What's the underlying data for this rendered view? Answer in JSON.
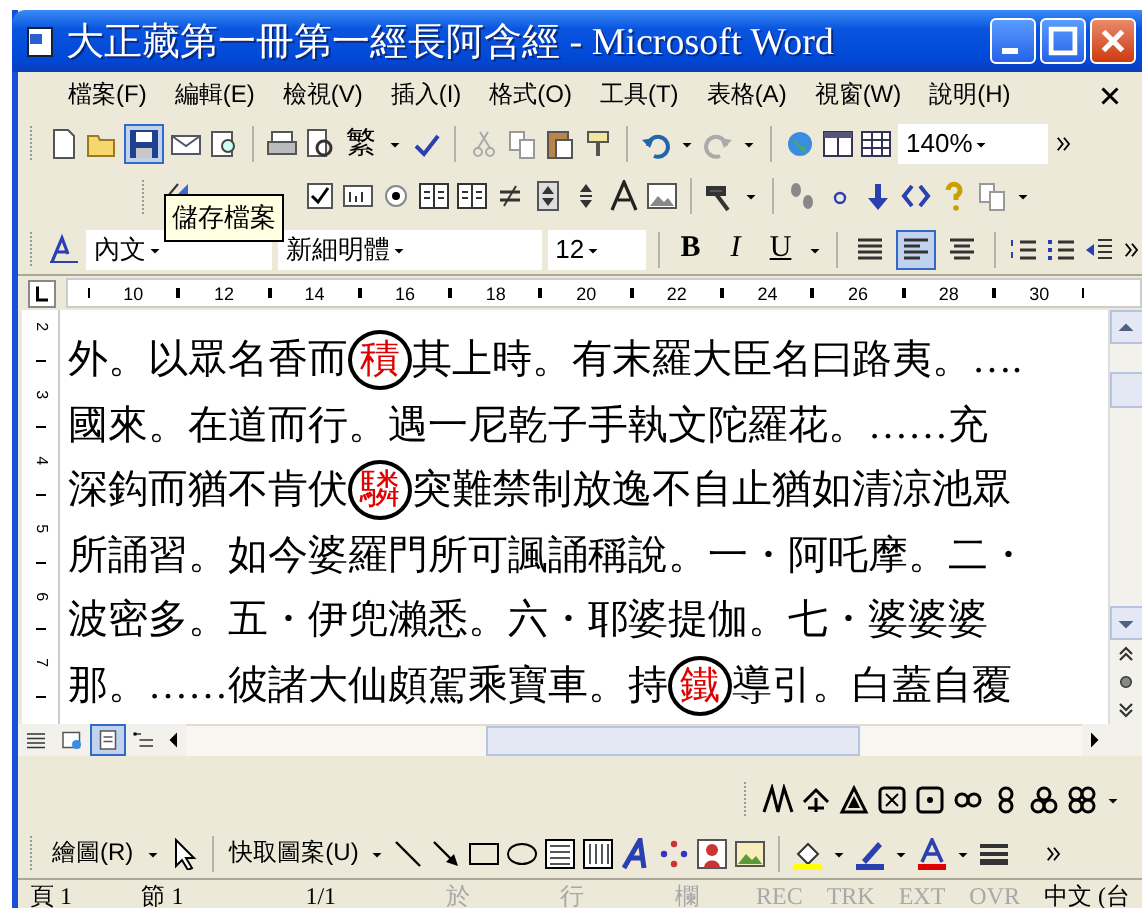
{
  "window": {
    "title": "大正藏第一冊第一經長阿含經 - Microsoft Word"
  },
  "menu": [
    "檔案(F)",
    "編輯(E)",
    "檢視(V)",
    "插入(I)",
    "格式(O)",
    "工具(T)",
    "表格(A)",
    "視窗(W)",
    "說明(H)"
  ],
  "standard_toolbar": {
    "convert": "繁",
    "zoom": "140%"
  },
  "tooltip": "儲存檔案",
  "formatting_toolbar": {
    "style": "內文",
    "font": "新細明體",
    "size": "12",
    "bold": "B",
    "italic": "I",
    "underline": "U",
    "alignments": [
      {
        "kind": "justify",
        "selected": false
      },
      {
        "kind": "left",
        "selected": true
      },
      {
        "kind": "center",
        "selected": false
      }
    ]
  },
  "ruler": {
    "numbers": [
      "10",
      "12",
      "14",
      "16",
      "18",
      "20",
      "22",
      "24",
      "26",
      "28",
      "30"
    ]
  },
  "vertical_ruler": {
    "numbers": [
      "2",
      "3",
      "4",
      "5",
      "6",
      "7"
    ]
  },
  "document": {
    "lines": [
      {
        "segments": [
          {
            "text": "外。以眾名香而",
            "marked": false
          },
          {
            "text": "積",
            "marked": true
          },
          {
            "text": "其上時。有末羅大臣名曰路夷。….",
            "marked": false
          }
        ]
      },
      {
        "segments": [
          {
            "text": "國來。在道而行。遇一尼乾子手執文陀羅花。……充",
            "marked": false
          }
        ]
      },
      {
        "segments": [
          {
            "text": "深鈎而猶不肯伏",
            "marked": false
          },
          {
            "text": "驎",
            "marked": true
          },
          {
            "text": "突難禁制放逸不自止猶如清涼池眾",
            "marked": false
          }
        ]
      },
      {
        "segments": [
          {
            "text": "所誦習。如今婆羅門所可諷誦稱說。一・阿吒摩。二・",
            "marked": false
          }
        ]
      },
      {
        "segments": [
          {
            "text": "波密多。五・伊兜瀨悉。六・耶婆提伽。七・婆婆婆",
            "marked": false
          }
        ]
      },
      {
        "segments": [
          {
            "text": "那。……彼諸大仙頗駕乘寶車。持",
            "marked": false
          },
          {
            "text": "鐵",
            "marked": true
          },
          {
            "text": "導引。白蓋自覆",
            "marked": false
          }
        ]
      }
    ]
  },
  "view_buttons": [
    {
      "kind": "normal",
      "selected": false
    },
    {
      "kind": "web",
      "selected": false
    },
    {
      "kind": "print",
      "selected": true
    },
    {
      "kind": "outline",
      "selected": false
    }
  ],
  "drawing_toolbar": {
    "draw_menu": "繪圖(R)",
    "autoshapes": "快取圖案(U)"
  },
  "status_bar": {
    "page": "頁 1",
    "section": "節 1",
    "pages": "1/1",
    "at": "於",
    "line": "行",
    "column": "欄",
    "modes": [
      {
        "label": "REC",
        "disabled": true
      },
      {
        "label": "TRK",
        "disabled": true
      },
      {
        "label": "EXT",
        "disabled": true
      },
      {
        "label": "OVR",
        "disabled": true
      }
    ],
    "language": "中文 (台"
  }
}
